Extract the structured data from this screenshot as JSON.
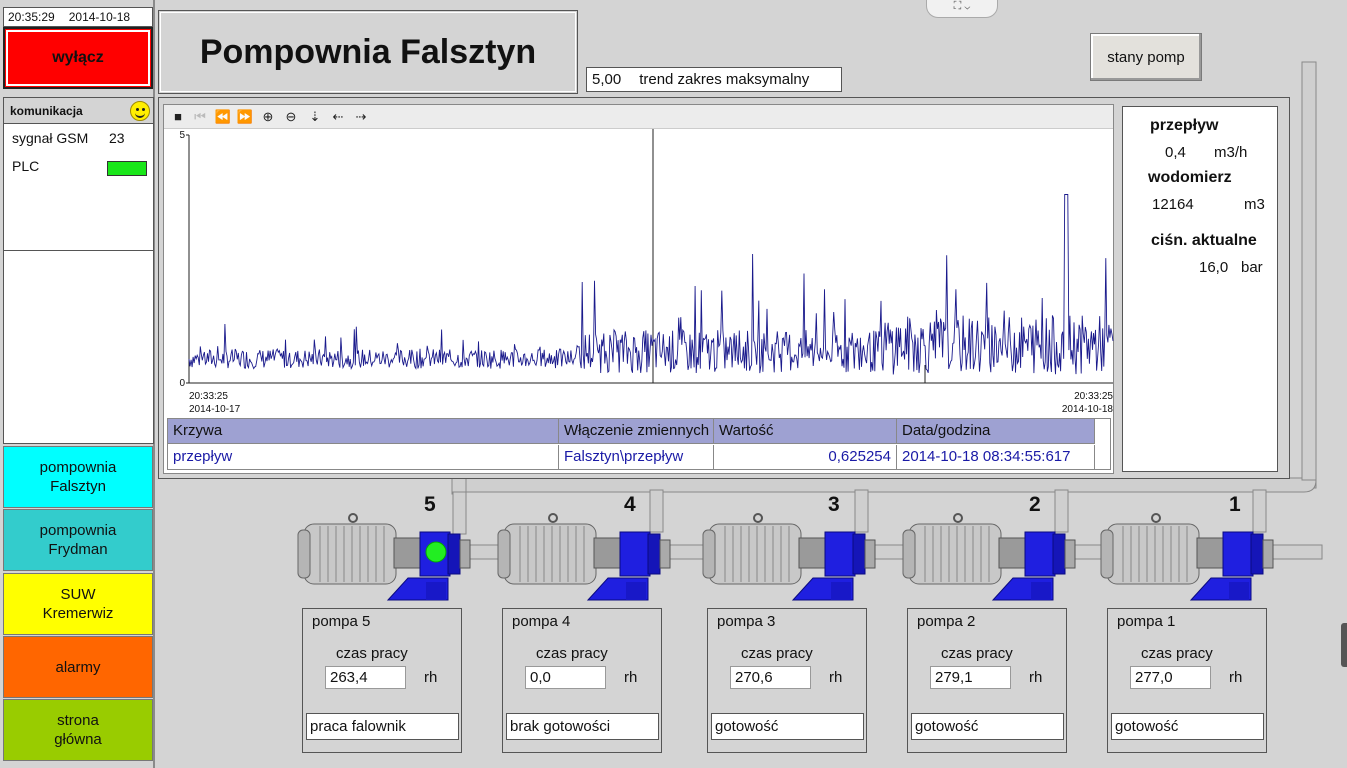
{
  "header": {
    "time": "20:35:29",
    "date": "2014-10-18"
  },
  "controls": {
    "off_label": "wyłącz",
    "pump_states_label": "stany pomp"
  },
  "communication": {
    "title": "komunikacja",
    "gsm_label": "sygnał GSM",
    "gsm_value": "23",
    "plc_label": "PLC",
    "plc_status_color": "#19e619",
    "status_icon": "smiley-icon"
  },
  "nav": [
    {
      "label": "pompownia\nFalsztyn",
      "color": "#00ffff"
    },
    {
      "label": "pompownia\nFrydman",
      "color": "#33cccc"
    },
    {
      "label": "SUW\nKremerwiz",
      "color": "#ffff00"
    },
    {
      "label": "alarmy",
      "color": "#ff6600"
    },
    {
      "label": "strona\ngłówna",
      "color": "#99cc00"
    }
  ],
  "page": {
    "title": "Pompownia Falsztyn"
  },
  "trend": {
    "range_value": "5,00",
    "range_label": "trend zakres maksymalny",
    "toolbar_icons": [
      "stop-icon",
      "first-page-icon",
      "rewind-icon",
      "forward-icon",
      "zoom-in-icon",
      "zoom-out-icon",
      "ruler-icon",
      "move-left-icon",
      "move-right-icon"
    ],
    "y_max_label": "5",
    "y_min_label": "0",
    "start_time": "20:33:25",
    "start_date": "2014-10-17",
    "end_time": "20:33:25",
    "end_date": "2014-10-18",
    "line_color": "#1a1a8c",
    "table": {
      "headers": [
        "Krzywa",
        "Włączenie zmiennych",
        "Wartość",
        "Data/godzina"
      ],
      "row": [
        "przepływ",
        "Falsztyn\\przepływ",
        "0,625254",
        "2014-10-18 08:34:55:617"
      ]
    }
  },
  "info": {
    "flow_label": "przepływ",
    "flow_value": "0,4",
    "flow_unit": "m3/h",
    "meter_label": "wodomierz",
    "meter_value": "12164",
    "meter_unit": "m3",
    "pressure_label": "ciśn. aktualne",
    "pressure_value": "16,0",
    "pressure_unit": "bar"
  },
  "pumps": [
    {
      "number": "5",
      "name": "pompa 5",
      "runtime_label": "czas pracy",
      "runtime": "263,4",
      "unit": "rh",
      "status": "praca falownik",
      "running": true
    },
    {
      "number": "4",
      "name": "pompa 4",
      "runtime_label": "czas pracy",
      "runtime": "0,0",
      "unit": "rh",
      "status": "brak gotowości",
      "running": false
    },
    {
      "number": "3",
      "name": "pompa 3",
      "runtime_label": "czas pracy",
      "runtime": "270,6",
      "unit": "rh",
      "status": "gotowość",
      "running": false
    },
    {
      "number": "2",
      "name": "pompa 2",
      "runtime_label": "czas pracy",
      "runtime": "279,1",
      "unit": "rh",
      "status": "gotowość",
      "running": false
    },
    {
      "number": "1",
      "name": "pompa 1",
      "runtime_label": "czas pracy",
      "runtime": "277,0",
      "unit": "rh",
      "status": "gotowość",
      "running": false
    }
  ],
  "colors": {
    "pump_body": "#1f1fe0",
    "motor": "#c8c8c8",
    "pipe": "#cfcfcf",
    "running_led": "#22ee22"
  }
}
